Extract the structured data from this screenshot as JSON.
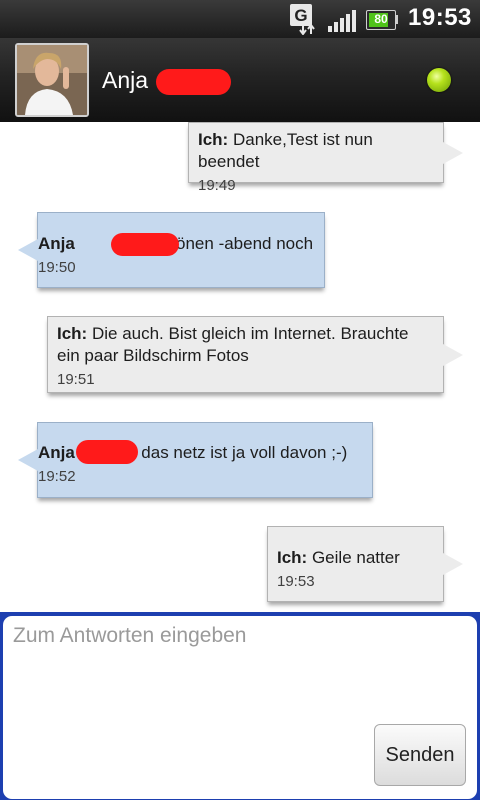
{
  "status_bar": {
    "network_icon": "g-data-transfer-icon",
    "signal_icon": "signal-strength-icon",
    "battery_level": "80",
    "battery_fill": 0.8,
    "time": "19:53"
  },
  "header": {
    "contact_name": "Anja",
    "avatar_icon": "contact-avatar",
    "presence_icon": "online-status-dot",
    "presence_color": "#9bd01a"
  },
  "messages": [
    {
      "direction": "out",
      "sender": "Ich:",
      "text": " Danke,Test ist nun beendet",
      "time": "19:49"
    },
    {
      "direction": "in",
      "sender": "Anja",
      "text": " schönen -abend noch",
      "time": "19:50"
    },
    {
      "direction": "out",
      "sender": "Ich:",
      "text": " Die auch. Bist gleich im Internet. Brauchte ein paar Bildschirm Fotos",
      "time": "19:51"
    },
    {
      "direction": "in",
      "sender": "Anja",
      "text": ": das netz ist ja voll davon ;-)",
      "time": "19:52"
    },
    {
      "direction": "out",
      "sender": "Ich:",
      "text": " Geile natter",
      "time": "19:53"
    }
  ],
  "compose": {
    "placeholder": "Zum Antworten eingeben",
    "send_label": "Senden"
  },
  "colors": {
    "incoming_bubble": "#c6d9ee",
    "outgoing_bubble": "#ececec",
    "compose_border": "#1d3fb0"
  }
}
